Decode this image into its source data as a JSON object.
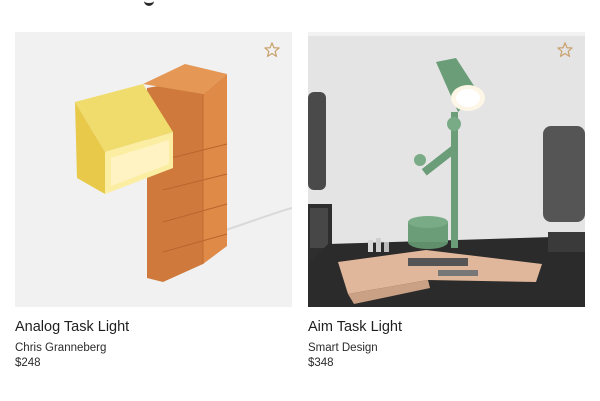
{
  "header": {
    "partial_heading_glyph": "g"
  },
  "products": [
    {
      "title": "Analog Task Light",
      "designer": "Chris Granneberg",
      "price": "$248",
      "favorite_icon": "star-outline-icon",
      "image_subject": "lamp-image"
    },
    {
      "title": "Aim Task Light",
      "designer": "Smart Design",
      "price": "$348",
      "favorite_icon": "star-outline-icon",
      "image_subject": "lamp-image"
    }
  ],
  "colors": {
    "star": "#c9a06a",
    "text": "#1f1f1f",
    "block_orange": "#d98746",
    "block_yellow": "#ecd55a",
    "lamp_green": "#6b9d78"
  }
}
